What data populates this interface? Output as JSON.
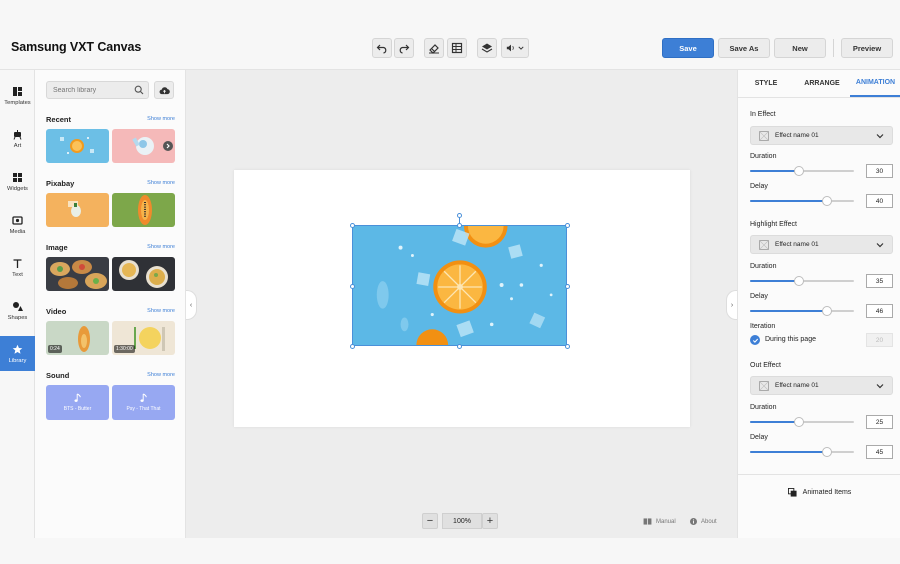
{
  "header": {
    "title": "Samsung VXT Canvas",
    "toolbar_icons": [
      "undo-icon",
      "redo-icon",
      "eraser-icon",
      "grid-icon",
      "layers-icon",
      "volume-icon"
    ],
    "save_label": "Save",
    "save_as_label": "Save As",
    "new_label": "New",
    "preview_label": "Preview",
    "accent": "#3d7fd6"
  },
  "rail": {
    "items": [
      {
        "label": "Templates",
        "icon": "templates-icon"
      },
      {
        "label": "Art",
        "icon": "art-icon"
      },
      {
        "label": "Widgets",
        "icon": "widgets-icon"
      },
      {
        "label": "Media",
        "icon": "media-icon"
      },
      {
        "label": "Text",
        "icon": "text-icon"
      },
      {
        "label": "Shapes",
        "icon": "shapes-icon"
      },
      {
        "label": "Library",
        "icon": "star-icon",
        "active": true
      }
    ]
  },
  "library": {
    "search_placeholder": "Search library",
    "show_more": "Show more",
    "sections": [
      {
        "title": "Recent"
      },
      {
        "title": "Pixabay"
      },
      {
        "title": "Image"
      },
      {
        "title": "Video",
        "durations": [
          "0:24",
          "1:30:00"
        ]
      },
      {
        "title": "Sound",
        "tracks": [
          "BTS - Butter",
          "Psy - That That"
        ]
      }
    ]
  },
  "canvas": {
    "zoom": "100%",
    "zoom_minus": "−",
    "zoom_plus": "+",
    "manual_label": "Manual",
    "about_label": "About"
  },
  "right_panel": {
    "tabs": [
      {
        "label": "STYLE"
      },
      {
        "label": "ARRANGE"
      },
      {
        "label": "ANIMATION",
        "active": true
      }
    ],
    "in_effect": {
      "title": "In Effect",
      "effect": "Effect name 01",
      "duration_label": "Duration",
      "duration": "30",
      "duration_pct": 0.47,
      "delay_label": "Delay",
      "delay": "40",
      "delay_pct": 0.74
    },
    "highlight_effect": {
      "title": "Highlight Effect",
      "effect": "Effect name 01",
      "duration_label": "Duration",
      "duration": "35",
      "duration_pct": 0.47,
      "delay_label": "Delay",
      "delay": "46",
      "delay_pct": 0.74,
      "iteration_label": "Iteration",
      "iteration_option": "During this page",
      "iteration_value": "20"
    },
    "out_effect": {
      "title": "Out Effect",
      "effect": "Effect name 01",
      "duration_label": "Duration",
      "duration": "25",
      "duration_pct": 0.47,
      "delay_label": "Delay",
      "delay": "45",
      "delay_pct": 0.74
    },
    "animated_items_label": "Animated Items"
  }
}
